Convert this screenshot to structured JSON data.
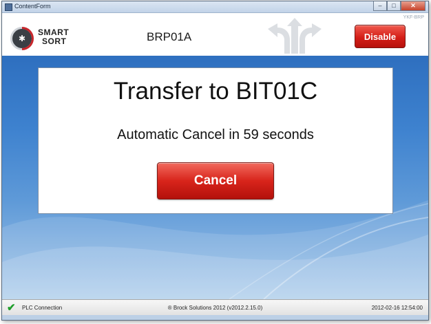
{
  "window": {
    "title": "ContentForm",
    "controls": {
      "minimize": "–",
      "maximize": "□",
      "close": "✕"
    }
  },
  "header": {
    "logo_line1": "SMART",
    "logo_line2": "SORT",
    "station": "BRP01A",
    "version_tag": "YKF-BRP",
    "disable_label": "Disable"
  },
  "dialog": {
    "title": "Transfer to BIT01C",
    "subtitle": "Automatic Cancel in 59 seconds",
    "cancel_label": "Cancel"
  },
  "status": {
    "plc_label": "PLC Connection",
    "copyright": "® Brock Solutions 2012 (v2012.2.15.0)",
    "datetime": "2012-02-16 12:54:00"
  },
  "colors": {
    "accent_red": "#d41e17",
    "background_blue": "#3e82cf",
    "status_ok": "#1e9e2a"
  },
  "icons": {
    "app": "form-icon",
    "logo": "smart-sort-logo-icon",
    "arrows": "direction-arrows-icon",
    "status": "checkmark-icon"
  }
}
